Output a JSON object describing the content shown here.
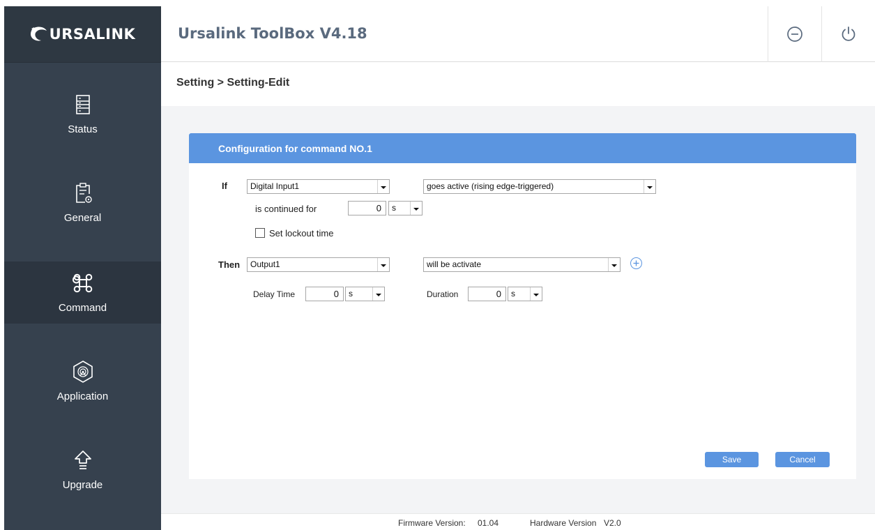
{
  "app": {
    "logo_text": "URSALINK",
    "title": "Ursalink ToolBox V4.18",
    "minimize_icon": "minus-circle-icon",
    "power_icon": "power-icon"
  },
  "sidebar": {
    "items": [
      {
        "label": "Status",
        "icon": "server-list-icon",
        "active": false
      },
      {
        "label": "General",
        "icon": "clipboard-gear-icon",
        "active": false
      },
      {
        "label": "Command",
        "icon": "command-key-icon",
        "active": true
      },
      {
        "label": "Application",
        "icon": "hexagon-radar-icon",
        "active": false
      },
      {
        "label": "Upgrade",
        "icon": "upload-arrow-icon",
        "active": false
      }
    ]
  },
  "breadcrumb": "Setting > Setting-Edit",
  "card": {
    "title": "Configuration for command NO.1",
    "if_label": "If",
    "if_source": "Digital Input1",
    "if_condition": "goes active (rising edge-triggered)",
    "continued_label": "is continued  for",
    "continued_value": "0",
    "continued_unit": "s",
    "lockout_label": "Set lockout time",
    "lockout_checked": false,
    "then_label": "Then",
    "then_target": "Output1",
    "then_action": "will be activate",
    "delay_label": "Delay Time",
    "delay_value": "0",
    "delay_unit": "s",
    "duration_label": "Duration",
    "duration_value": "0",
    "duration_unit": "s",
    "add_icon": "plus-circle-icon",
    "save_label": "Save",
    "cancel_label": "Cancel"
  },
  "footer": {
    "firmware_label": "Firmware Version:",
    "firmware_value": "01.04",
    "hardware_label": "Hardware Version",
    "hardware_value": "V2.0"
  },
  "colors": {
    "sidebar": "#36414e",
    "sidebar_active": "#2c3540",
    "accent": "#5b95e0",
    "title_text": "#5a6a7e"
  }
}
